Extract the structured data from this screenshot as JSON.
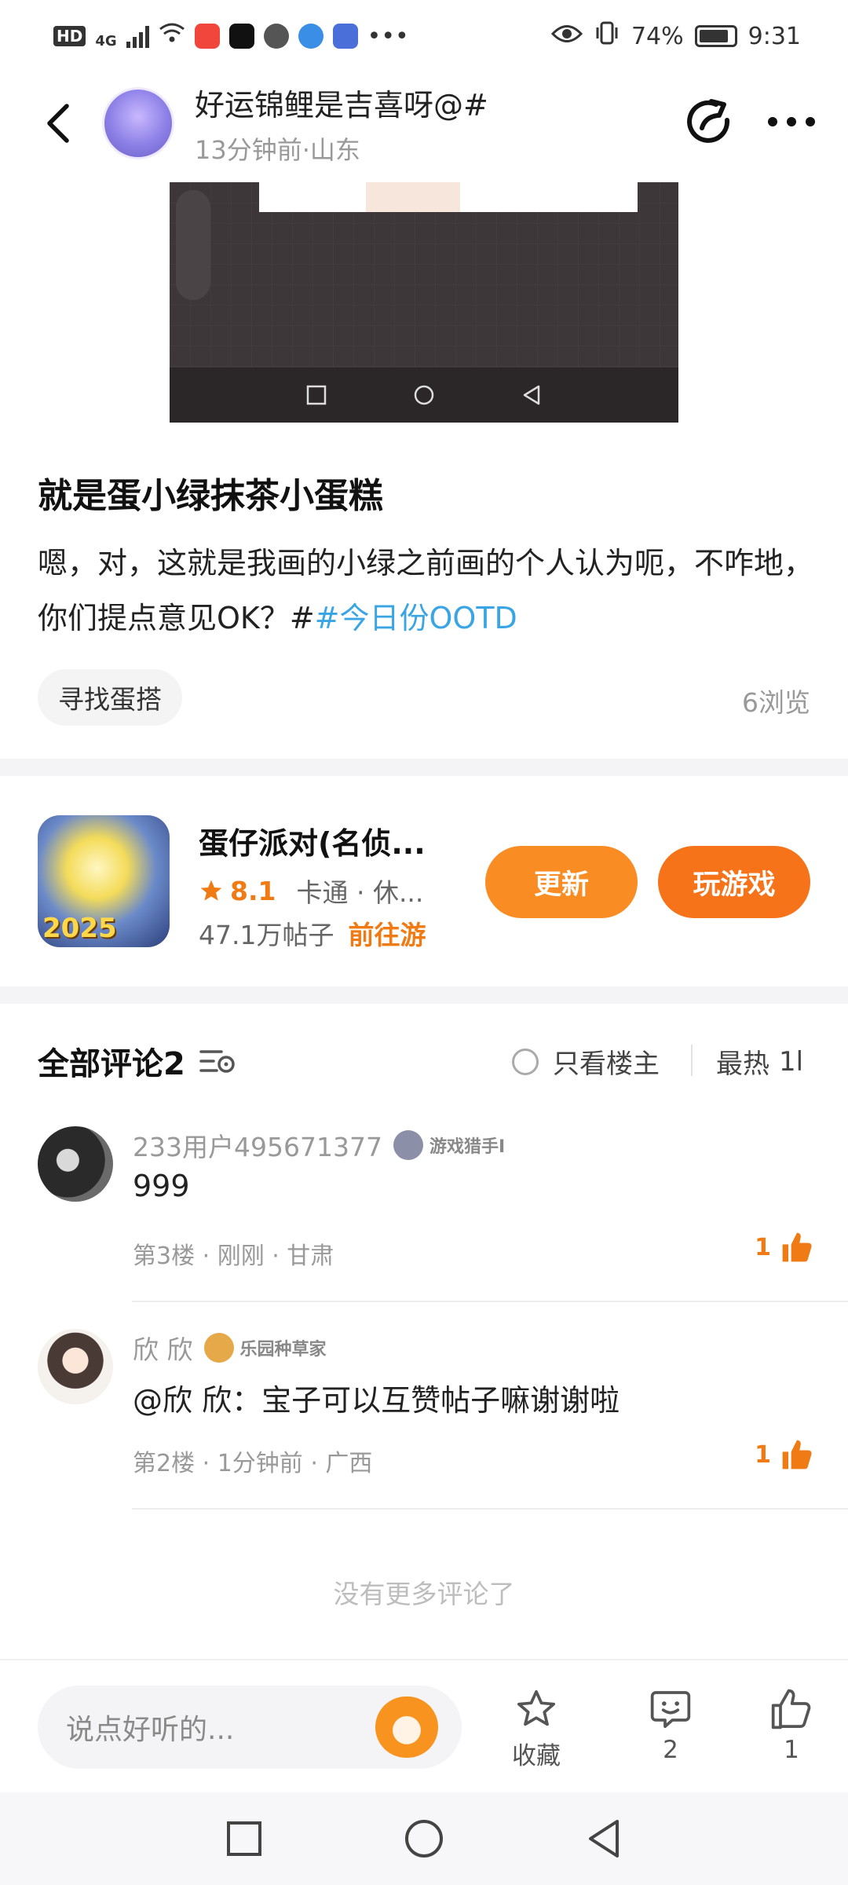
{
  "status_bar": {
    "hd": "HD",
    "net": "4G",
    "battery": "74%",
    "time": "9:31",
    "icons": [
      "signal-icon",
      "wifi-icon",
      "app-icon",
      "tiktok-icon",
      "wechat-icon",
      "browser-icon",
      "app-icon",
      "more-dots-icon",
      "eye-icon",
      "vibrate-icon",
      "battery-icon"
    ]
  },
  "header": {
    "author_name": "好运锦鲤是吉喜呀@#",
    "author_meta": "13分钟前·山东"
  },
  "post": {
    "title": "就是蛋小绿抹茶小蛋糕",
    "body_text": "嗯，对，这就是我画的小绿之前画的个人认为呃，不咋地，你们提点意见OK？#",
    "hashtag": "#今日份OOTD",
    "tag": "寻找蛋搭",
    "views": "6浏览"
  },
  "game": {
    "name": "蛋仔派对(名侦...",
    "rating": "8.1",
    "genre": "卡通 · 休...",
    "posts": "47.1万帖子",
    "go_label": "前往游",
    "year_badge": "2025",
    "update_label": "更新",
    "play_label": "玩游戏"
  },
  "comments_header": {
    "title": "全部评论2",
    "only_op": "只看楼主",
    "sort": "最热",
    "sort_symbol": "1l"
  },
  "comments": [
    {
      "name": "233用户495671377",
      "badge": "游戏猎手I",
      "text": "999",
      "meta": "第3楼 · 刚刚 · 甘肃",
      "likes": "1"
    },
    {
      "name": "欣 欣",
      "badge": "乐园种草家",
      "text": "@欣 欣：宝子可以互赞帖子嘛谢谢啦",
      "meta": "第2楼 · 1分钟前 · 广西",
      "likes": "1"
    }
  ],
  "no_more": "没有更多评论了",
  "bottom_bar": {
    "input_placeholder": "说点好听的...",
    "favorite_label": "收藏",
    "comment_count": "2",
    "like_count": "1"
  },
  "colors": {
    "accent_orange": "#f6731a",
    "update_orange": "#f98c22",
    "hashtag_blue": "#3aa5e4"
  }
}
